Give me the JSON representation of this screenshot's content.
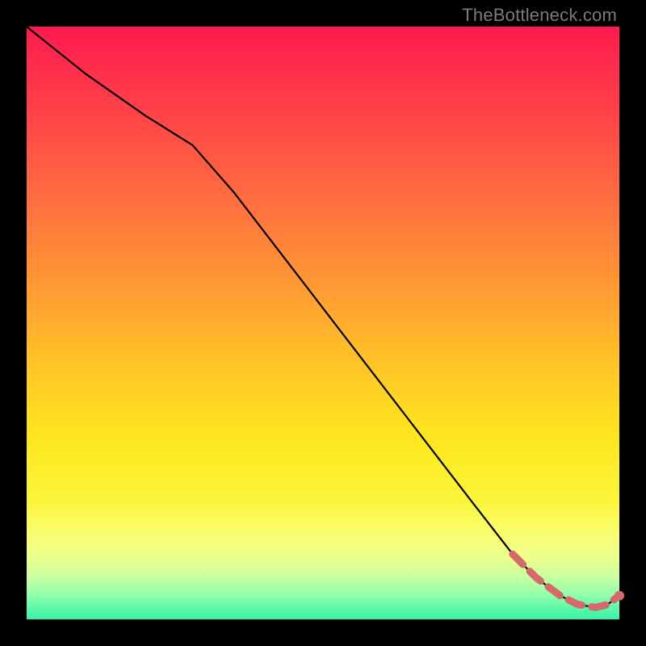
{
  "watermark": "TheBottleneck.com",
  "colors": {
    "background": "#000000",
    "curve": "#000000",
    "trail": "#d66a6a",
    "dot": "#d66a6a"
  },
  "chart_data": {
    "type": "line",
    "title": "",
    "xlabel": "",
    "ylabel": "",
    "xlim": [
      0,
      100
    ],
    "ylim": [
      0,
      100
    ],
    "grid": false,
    "legend": false,
    "series": [
      {
        "name": "bottleneck-curve",
        "x": [
          0,
          10,
          20,
          28,
          35,
          45,
          55,
          65,
          75,
          82,
          86,
          90,
          93,
          96,
          98,
          100
        ],
        "y": [
          100,
          92,
          85,
          80,
          72,
          59,
          46,
          33,
          20,
          11,
          7,
          4,
          2.5,
          2,
          2.5,
          4
        ]
      }
    ],
    "trail": {
      "name": "highlight-trail",
      "x": [
        82,
        86,
        90,
        93,
        96,
        98,
        100
      ],
      "y": [
        11,
        7,
        4,
        2.5,
        2,
        2.5,
        4
      ]
    },
    "end_dot": {
      "x": 100,
      "y": 4
    }
  }
}
